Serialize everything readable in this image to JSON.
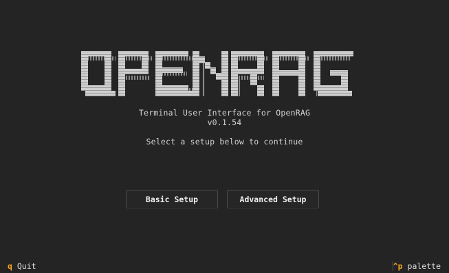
{
  "logo": {
    "text": "OPENRAG",
    "fill": "#d8d8d8",
    "shadow": "#8e8e8e"
  },
  "subtitle": "Terminal User Interface for OpenRAG",
  "version": "v0.1.54",
  "prompt": "Select a setup below to continue",
  "buttons": {
    "basic": "Basic Setup",
    "advanced": "Advanced Setup"
  },
  "footer": {
    "quit_key": "q",
    "quit_label": "Quit",
    "palette_key": "^p",
    "palette_label": "palette"
  },
  "colors": {
    "background": "#242424",
    "key_accent": "#f5a623"
  }
}
